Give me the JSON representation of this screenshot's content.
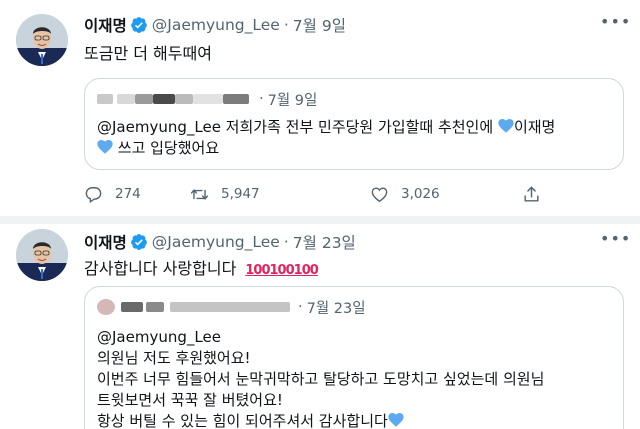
{
  "tweets": [
    {
      "author": "이재명",
      "handle": "@Jaemyung_Lee",
      "dot": "·",
      "date": "7월 9일",
      "text": "또금만 더 해두때여",
      "quote": {
        "date": "7월 9일",
        "lines": [
          "@Jaemyung_Lee 저희가족 전부 민주당원 가입할때 추천인에 ",
          "이재명",
          " 쓰고 입당했어요"
        ]
      },
      "stats": {
        "replies": "274",
        "retweets": "5,947",
        "likes": "3,026"
      }
    },
    {
      "author": "이재명",
      "handle": "@Jaemyung_Lee",
      "dot": "·",
      "date": "7월 23일",
      "text": "감사합니다 사랑합니다 ",
      "hundred": "100100100",
      "quote": {
        "date": "7월 23일",
        "lines": [
          "@Jaemyung_Lee",
          "의원님 저도 후원했어요!",
          "이번주 너무 힘들어서 눈막귀막하고 탈당하고 도망치고 싶었는데 의원님",
          "트윗보면서 꾹꾹 잘 버텼어요!",
          "항상 버틸 수 있는 힘이 되어주셔서 감사합니다"
        ]
      }
    }
  ],
  "colors": {
    "accent": "#1d9bf0",
    "secondary_text": "#536471",
    "border": "#cfd9de",
    "heart": "#5eaaf1"
  },
  "icons": [
    "verified-badge-icon",
    "more-icon",
    "reply-icon",
    "retweet-icon",
    "like-icon",
    "share-icon",
    "blue-heart-icon",
    "hundred-points-emoji"
  ]
}
